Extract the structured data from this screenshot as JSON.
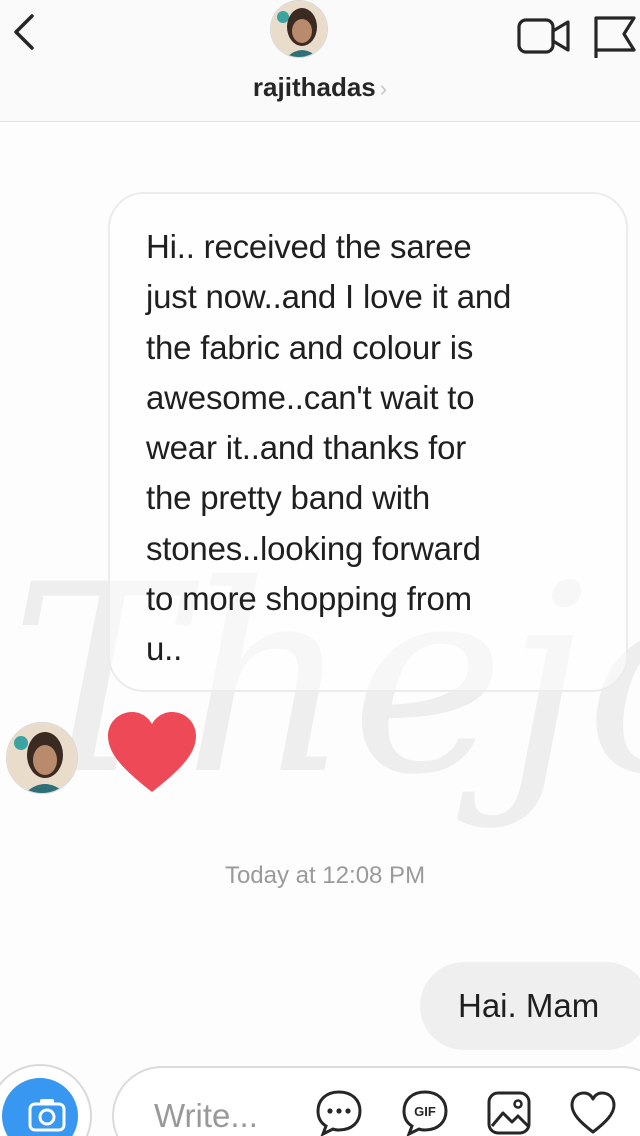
{
  "header": {
    "username": "rajithadas",
    "chevron": "›",
    "icons": {
      "back": "chevron-left-icon",
      "video": "video-call-icon",
      "flag": "flag-icon"
    }
  },
  "watermark": {
    "text": "Thejo"
  },
  "conversation": {
    "incoming_message": "Hi.. received the saree\njust now..and I love it and\nthe fabric and colour is\nawesome..can't wait to\nwear it..and thanks for\nthe pretty band with\nstones..looking forward\nto more shopping from\nu..",
    "reaction": "heart",
    "timestamp": "Today at 12:08 PM",
    "outgoing_message": "Hai. Mam"
  },
  "composer": {
    "placeholder": "Write...",
    "icons": [
      "camera-icon",
      "chat-dots-icon",
      "gif-icon",
      "image-icon",
      "heart-icon"
    ],
    "gif_label": "GIF"
  },
  "colors": {
    "accent_blue": "#3897f0",
    "heart_red": "#ed4956"
  }
}
